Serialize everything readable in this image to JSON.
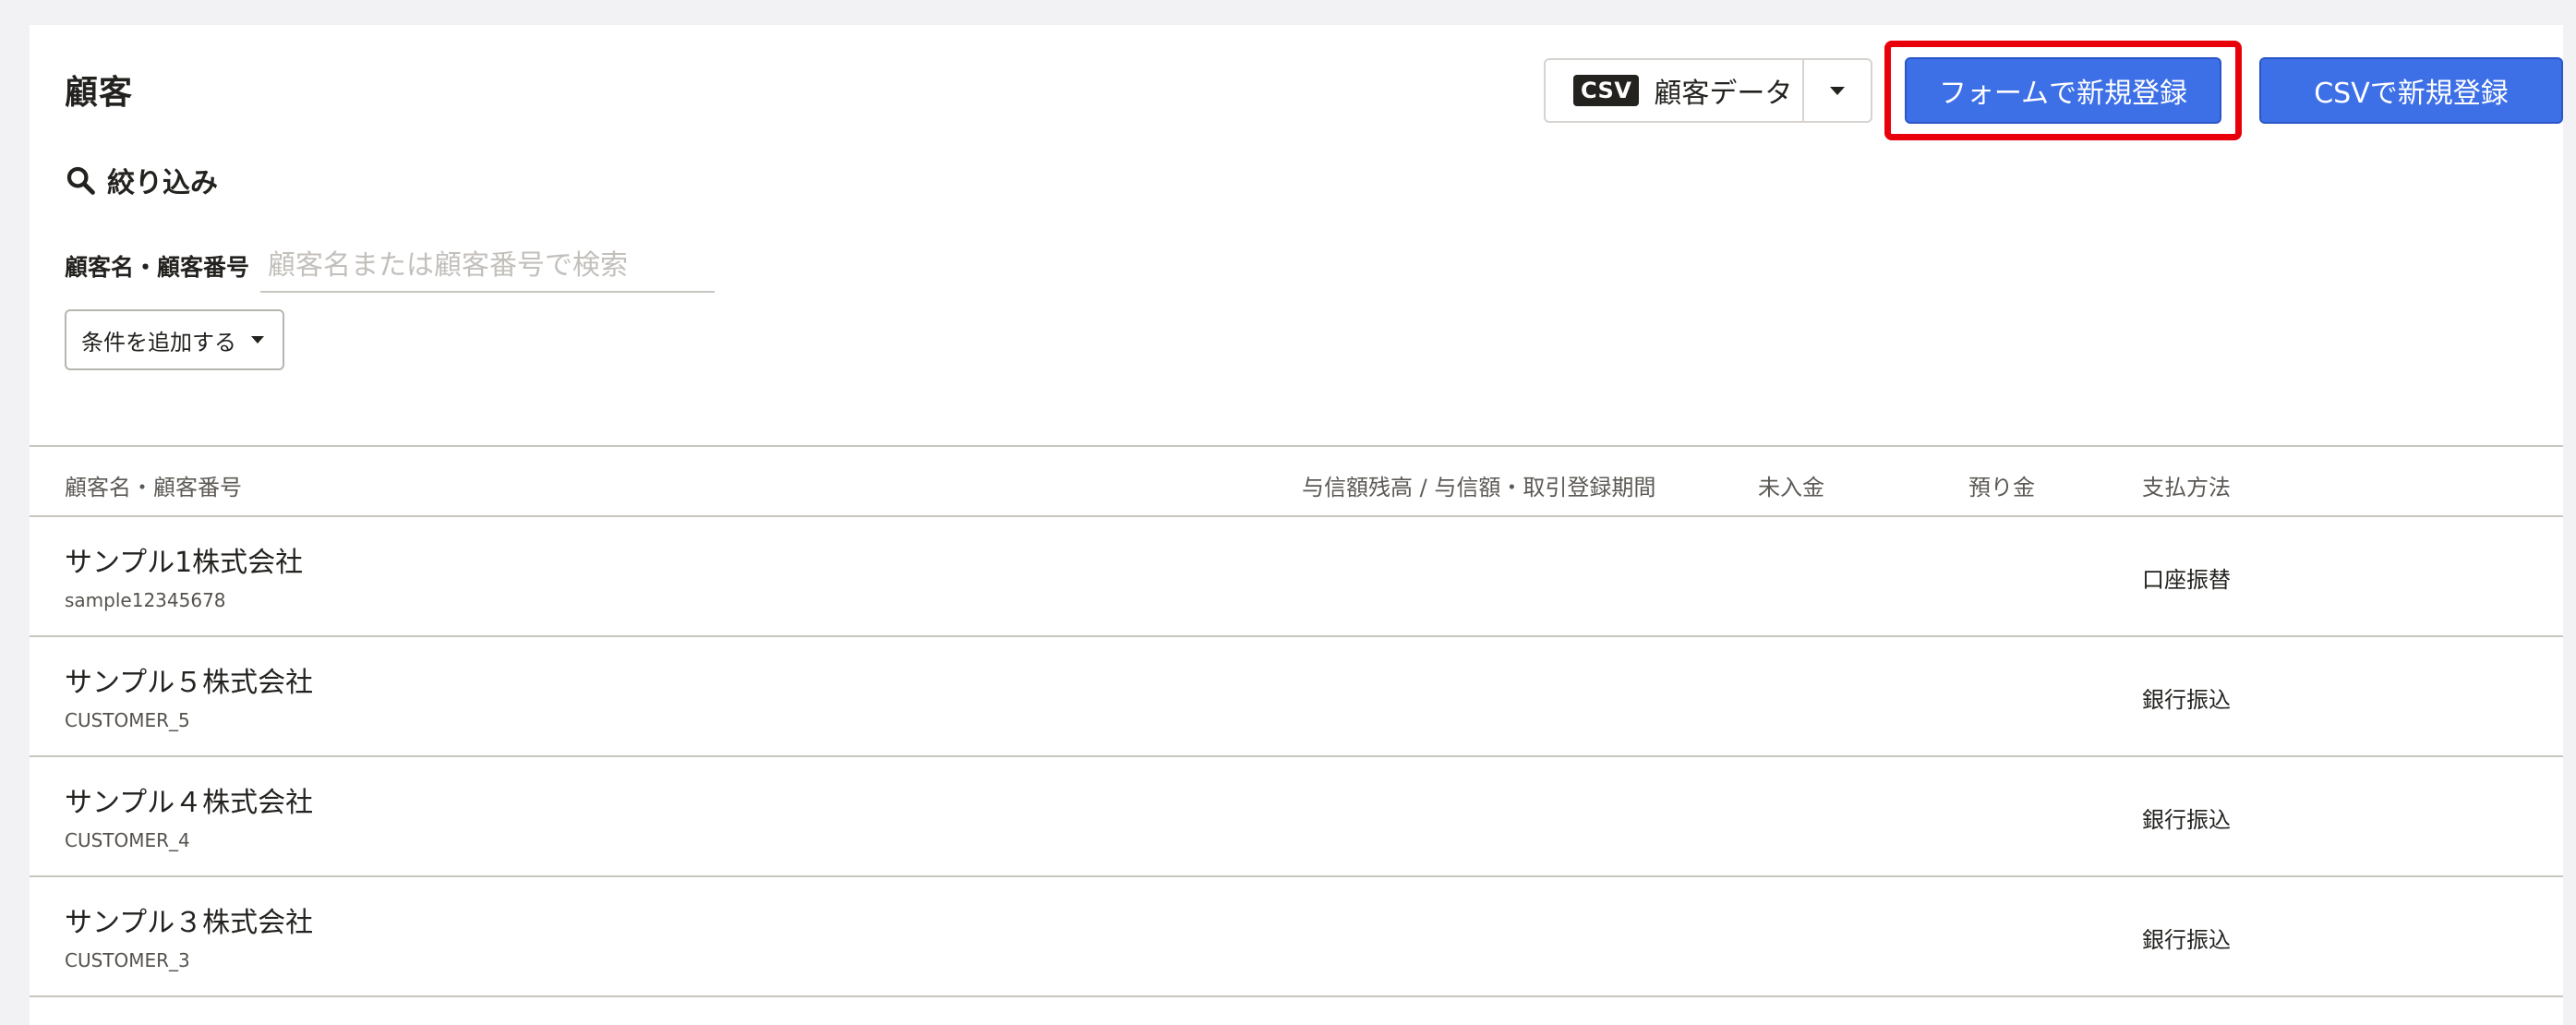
{
  "header": {
    "title": "顧客",
    "csv_badge": "CSV",
    "csv_label": "顧客データ",
    "form_register_label": "フォームで新規登録",
    "csv_register_label": "CSVで新規登録"
  },
  "filter": {
    "title": "絞り込み",
    "field_label": "顧客名・顧客番号",
    "search_placeholder": "顧客名または顧客番号で検索",
    "search_value": "",
    "add_condition_label": "条件を追加する"
  },
  "table": {
    "columns": [
      "顧客名・顧客番号",
      "与信額残高 / 与信額・取引登録期間",
      "未入金",
      "預り金",
      "支払方法"
    ],
    "rows": [
      {
        "name": "サンプル1株式会社",
        "code": "sample12345678",
        "payment": "口座振替"
      },
      {
        "name": "サンプル５株式会社",
        "code": "CUSTOMER_5",
        "payment": "銀行振込"
      },
      {
        "name": "サンプル４株式会社",
        "code": "CUSTOMER_4",
        "payment": "銀行振込"
      },
      {
        "name": "サンプル３株式会社",
        "code": "CUSTOMER_3",
        "payment": "銀行振込"
      }
    ]
  },
  "colors": {
    "primary": "#3d6fe6",
    "highlight": "#e8000b"
  },
  "icons": {
    "search": "search-icon",
    "caret": "chevron-down-icon"
  }
}
